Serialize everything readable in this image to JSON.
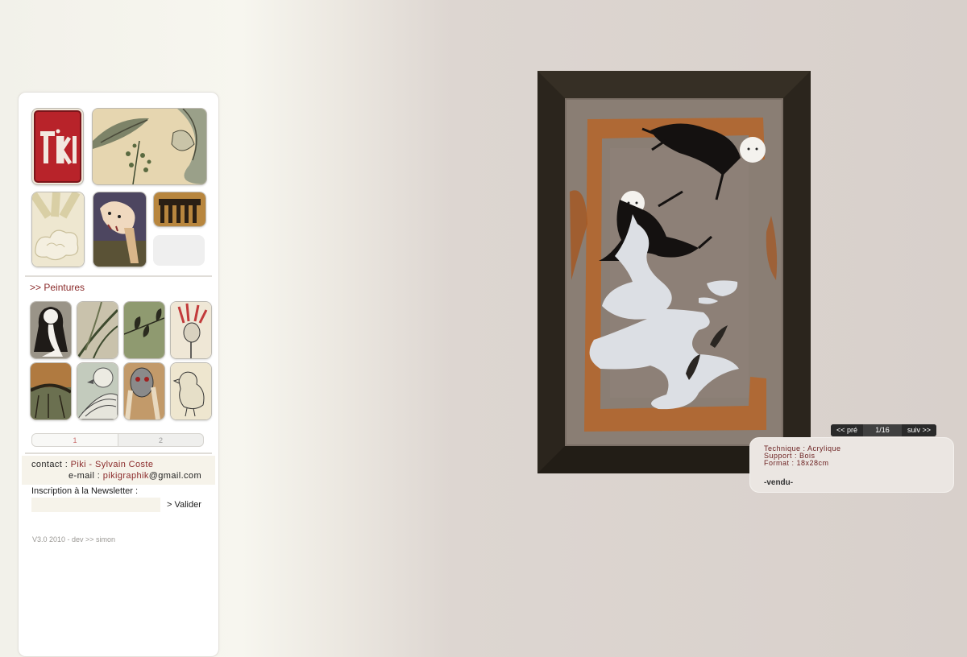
{
  "sidebar": {
    "logo_text": "PIKI",
    "section_link": ">> Peintures",
    "pager": [
      "1",
      "2"
    ],
    "contact": {
      "label": "contact :",
      "name": "Piki - Sylvain Coste",
      "email_label": "e-mail :",
      "email_user": "pikigraphik",
      "email_domain": "@gmail.com"
    },
    "newsletter": {
      "label": "Inscription à la Newsletter :",
      "input_value": "",
      "button": "> Valider"
    },
    "footer": "V3.0 2010 - dev >> simon"
  },
  "viewer": {
    "nav": {
      "prev": "<< pré",
      "count": "1/16",
      "next": "suiv >>"
    },
    "info": {
      "technique": "Technique : Acrylique",
      "support": "Support : Bois",
      "format": "Format : 18x28cm",
      "status": "-vendu-"
    }
  },
  "colors": {
    "accent": "#8a2a2a",
    "logo_red": "#b8232a",
    "frame": "#2b251d"
  }
}
